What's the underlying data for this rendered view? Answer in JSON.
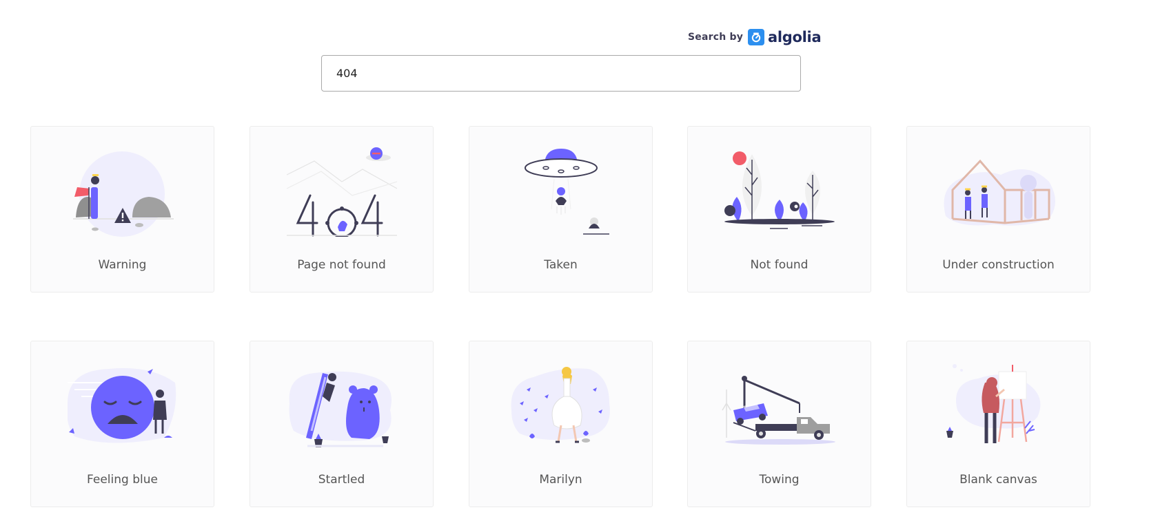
{
  "search": {
    "value": "404",
    "powered_by_label": "Search by",
    "brand_name": "algolia"
  },
  "colors": {
    "accent": "#6c63ff",
    "dark": "#3f3d56",
    "alert": "#f25c69",
    "card_background": "#fbfbfc",
    "card_border": "#ececec",
    "algolia_blue": "#2c8fef"
  },
  "illustrations": [
    {
      "label": "Warning",
      "icon": "warning-illustration-icon"
    },
    {
      "label": "Page not found",
      "icon": "page-not-found-illustration-icon"
    },
    {
      "label": "Taken",
      "icon": "ufo-taken-illustration-icon"
    },
    {
      "label": "Not found",
      "icon": "not-found-trees-illustration-icon"
    },
    {
      "label": "Under construction",
      "icon": "under-construction-illustration-icon"
    },
    {
      "label": "Feeling blue",
      "icon": "sad-face-illustration-icon"
    },
    {
      "label": "Startled",
      "icon": "startled-illustration-icon"
    },
    {
      "label": "Marilyn",
      "icon": "marilyn-illustration-icon"
    },
    {
      "label": "Towing",
      "icon": "tow-truck-illustration-icon"
    },
    {
      "label": "Blank canvas",
      "icon": "blank-canvas-illustration-icon"
    }
  ]
}
